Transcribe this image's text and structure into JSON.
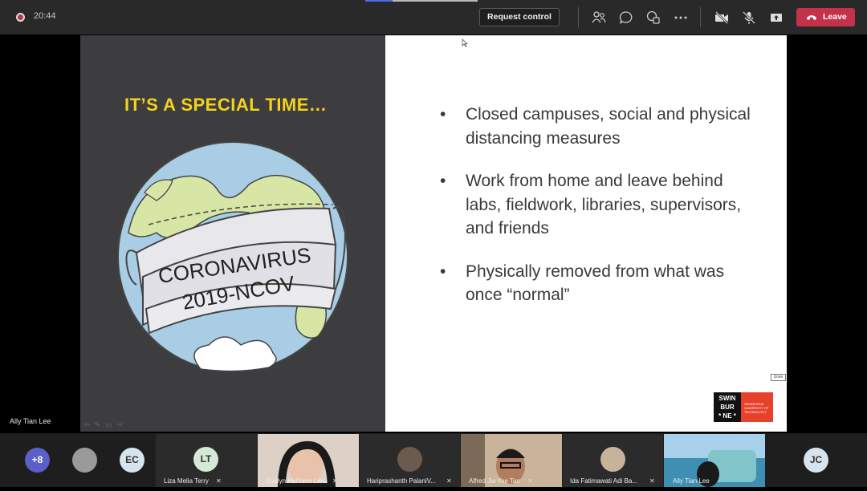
{
  "toolbar": {
    "timer": "20:44",
    "request_control_label": "Request control",
    "leave_label": "Leave",
    "icons": [
      "participants-icon",
      "chat-icon",
      "reactions-icon",
      "more-icon",
      "camera-off-icon",
      "mic-off-icon",
      "share-icon",
      "phone-icon"
    ],
    "colors": {
      "bar": "#292929",
      "leave": "#c4314b"
    }
  },
  "slide": {
    "title": "IT’S A SPECIAL TIME…",
    "bullets": [
      "Closed campuses, social and physical distancing measures",
      "Work from home and leave behind labs, fieldwork, libraries, supervisors, and friends",
      "Physically removed from what was once “normal”"
    ],
    "bullet_glyph": "•",
    "mask_text_line1": "CORONAVIRUS",
    "mask_text_line2": "2019-NCOV",
    "logo_text": [
      "SWIN",
      "BUR",
      "* NE *"
    ],
    "logo_subtext": "SWINBURNE UNIVERSITY OF TECHNOLOGY",
    "close_tag": "close",
    "colors": {
      "title": "#f5d31c",
      "left_bg": "#3d3d3f",
      "logo_red": "#e8412b"
    }
  },
  "presenter": {
    "name": "Ally Tian Lee"
  },
  "participants": [
    {
      "type": "overflow",
      "label": "+8"
    },
    {
      "type": "blank"
    },
    {
      "type": "initials",
      "initials": "EC"
    },
    {
      "type": "tile",
      "initials": "LT",
      "name": "Liza Melia Terry",
      "muted": true
    },
    {
      "type": "video",
      "name": "Evelyn HuiYann Liew",
      "muted": true
    },
    {
      "type": "avatar-photo",
      "name": "Hariprashanth PalaniV...",
      "muted": true
    },
    {
      "type": "video",
      "name": "Alfred Jia Yee Tan",
      "muted": true
    },
    {
      "type": "avatar-photo",
      "name": "Ida Fatimawati Adi Ba...",
      "muted": true
    },
    {
      "type": "video",
      "name": "Ally Tian Lee",
      "muted": false
    },
    {
      "type": "initials",
      "initials": "JC"
    }
  ]
}
